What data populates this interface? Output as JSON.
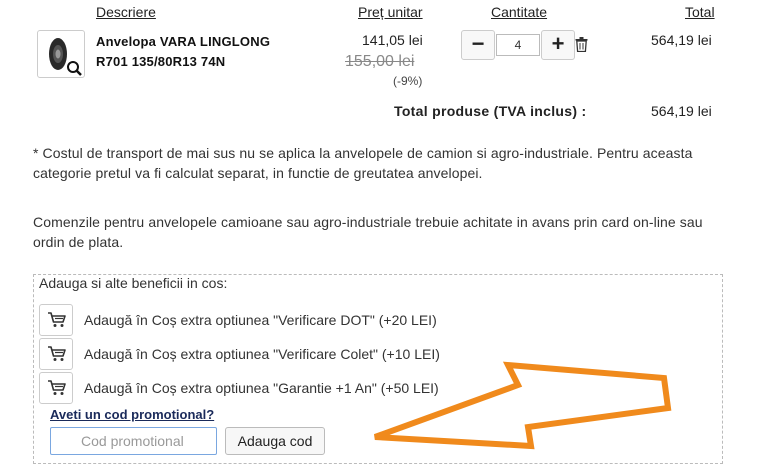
{
  "table_header": {
    "description": "Descriere",
    "unit_price": "Preț unitar",
    "quantity": "Cantitate",
    "total": "Total"
  },
  "product": {
    "name": "Anvelopa VARA LINGLONG R701 135/80R13 74N",
    "price_now": "141,05 lei",
    "price_old": "155,00 lei",
    "discount": "(-9%)",
    "quantity": "4",
    "line_total": "564,19 lei"
  },
  "summary": {
    "label": "Total produse  (TVA inclus) :",
    "value": "564,19 lei"
  },
  "notes": {
    "transport": "* Costul de transport de mai sus nu se aplica la anvelopele de camion si agro-industriale. Pentru aceasta categorie pretul va fi calculat separat, in functie de greutatea anvelopei.",
    "payment": "Comenzile pentru anvelopele camioane sau agro-industriale trebuie achitate in avans prin card on-line sau ordin de plata."
  },
  "benefits": {
    "title": "Adauga si alte beneficii in cos:",
    "items": [
      "Adaugă în Coș extra optiunea \"Verificare DOT\" (+20 LEI)",
      "Adaugă în Coș extra optiunea \"Verificare Colet\" (+10 LEI)",
      "Adaugă în Coș extra optiunea \"Garantie +1 An\" (+50 LEI)"
    ]
  },
  "promo": {
    "title": "Aveti un cod promotional?",
    "placeholder": "Cod promotional",
    "button": "Adauga cod"
  },
  "icons": {
    "thumbnail": "tire-zoom-icon",
    "minus": "minus-icon",
    "plus": "plus-icon",
    "delete": "trash-icon",
    "cart": "cart-icon",
    "annotation": "arrow-annotation"
  },
  "colors": {
    "annotation_arrow": "#f08a1c",
    "promo_title": "#1a2a5a",
    "input_focus_border": "#7aa7e0"
  }
}
